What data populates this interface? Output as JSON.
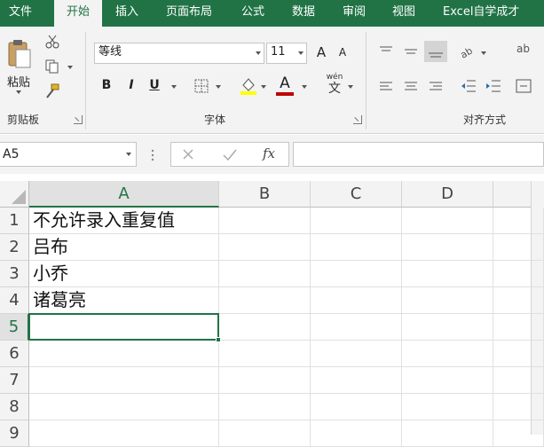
{
  "tabs": [
    "文件",
    "开始",
    "插入",
    "页面布局",
    "公式",
    "数据",
    "审阅",
    "视图",
    "Excel自学成才"
  ],
  "active_tab": "开始",
  "ribbon": {
    "clipboard": {
      "paste_label": "粘贴",
      "group_label": "剪贴板"
    },
    "font": {
      "font_name": "等线",
      "font_size": "11",
      "grow_label": "A",
      "shrink_label": "A",
      "bold": "B",
      "italic": "I",
      "underline": "U",
      "font_color_letter": "A",
      "phonetic_top": "wén",
      "phonetic_bottom": "文",
      "group_label": "字体"
    },
    "alignment": {
      "group_label": "对齐方式",
      "orientation_label": "ab"
    }
  },
  "formula_bar": {
    "name_box": "A5",
    "fx_label": "fx",
    "formula_value": ""
  },
  "sheet": {
    "columns": [
      "A",
      "B",
      "C",
      "D"
    ],
    "selected_column": "A",
    "rows": [
      "1",
      "2",
      "3",
      "4",
      "5",
      "6",
      "7",
      "8",
      "9"
    ],
    "selected_row": "5",
    "cells_A": [
      "不允许录入重复值",
      "吕布",
      "小乔",
      "诸葛亮",
      "",
      "",
      "",
      "",
      ""
    ]
  },
  "colors": {
    "brand": "#217346",
    "ribbon_bg": "#f3f3f3",
    "font_color_bar": "#c00000",
    "highlight_bar": "#ffff00"
  }
}
